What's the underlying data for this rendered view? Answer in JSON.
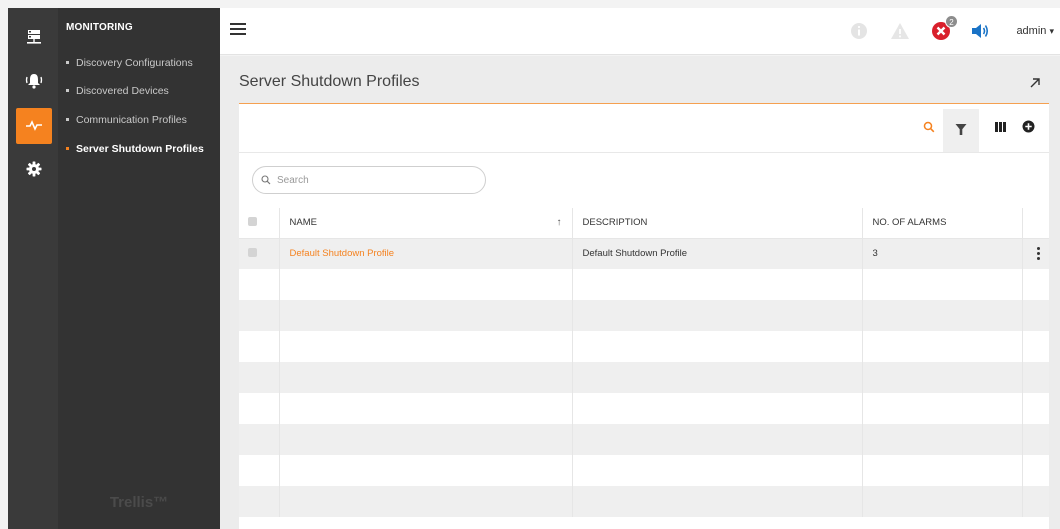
{
  "nav": {
    "section_title": "MONITORING",
    "items": [
      {
        "label": "Discovery Configurations",
        "active": false
      },
      {
        "label": "Discovered Devices",
        "active": false
      },
      {
        "label": "Communication Profiles",
        "active": false
      },
      {
        "label": "Server Shutdown Profiles",
        "active": true
      }
    ],
    "brand": "Trellis™",
    "rail_icons": [
      "server-icon",
      "alarm-bell-icon",
      "activity-pulse-icon",
      "gear-icon"
    ],
    "accent_color": "#f5821f"
  },
  "topbar": {
    "icons": [
      "info-icon",
      "warning-icon",
      "critical-alarm-icon",
      "speaker-icon"
    ],
    "critical_badge_count": "2",
    "user_label": "admin"
  },
  "page": {
    "title": "Server Shutdown Profiles"
  },
  "toolbar": {
    "icons": [
      "search-icon",
      "filter-icon",
      "columns-icon",
      "add-circle-icon"
    ]
  },
  "search": {
    "placeholder": "Search",
    "value": ""
  },
  "table": {
    "columns": [
      "NAME",
      "DESCRIPTION",
      "NO. OF ALARMS"
    ],
    "sort_indicator": "↑",
    "rows": [
      {
        "name": "Default Shutdown Profile",
        "description": "Default Shutdown Profile",
        "alarms": "3"
      }
    ]
  }
}
